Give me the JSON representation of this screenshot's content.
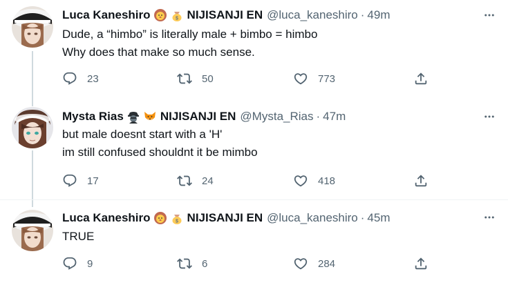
{
  "tweets": [
    {
      "name": "Luca Kaneshiro",
      "emojis": [
        "lion-emoji",
        "money-bag-emoji"
      ],
      "affiliation": "NIJISANJI EN",
      "handle": "@luca_kaneshiro",
      "separator": "·",
      "time": "49m",
      "lines": [
        "Dude, a “himbo” is literally male + bimbo = himbo",
        "Why does that make so much sense."
      ],
      "replies": "23",
      "retweets": "50",
      "likes": "773"
    },
    {
      "name": "Mysta Rias",
      "emojis": [
        "detective-emoji",
        "fox-emoji"
      ],
      "affiliation": "NIJISANJI EN",
      "handle": "@Mysta_Rias",
      "separator": "·",
      "time": "47m",
      "lines": [
        "but male doesnt start with a 'H'",
        "im still confused shouldnt it be mimbo"
      ],
      "replies": "17",
      "retweets": "24",
      "likes": "418"
    },
    {
      "name": "Luca Kaneshiro",
      "emojis": [
        "lion-emoji",
        "money-bag-emoji"
      ],
      "affiliation": "NIJISANJI EN",
      "handle": "@luca_kaneshiro",
      "separator": "·",
      "time": "45m",
      "lines": [
        "TRUE"
      ],
      "replies": "9",
      "retweets": "6",
      "likes": "284"
    }
  ],
  "colors": {
    "text": "#0f1419",
    "secondary": "#536471",
    "thread_line": "#cfd9de",
    "divider": "#eff3f4"
  }
}
